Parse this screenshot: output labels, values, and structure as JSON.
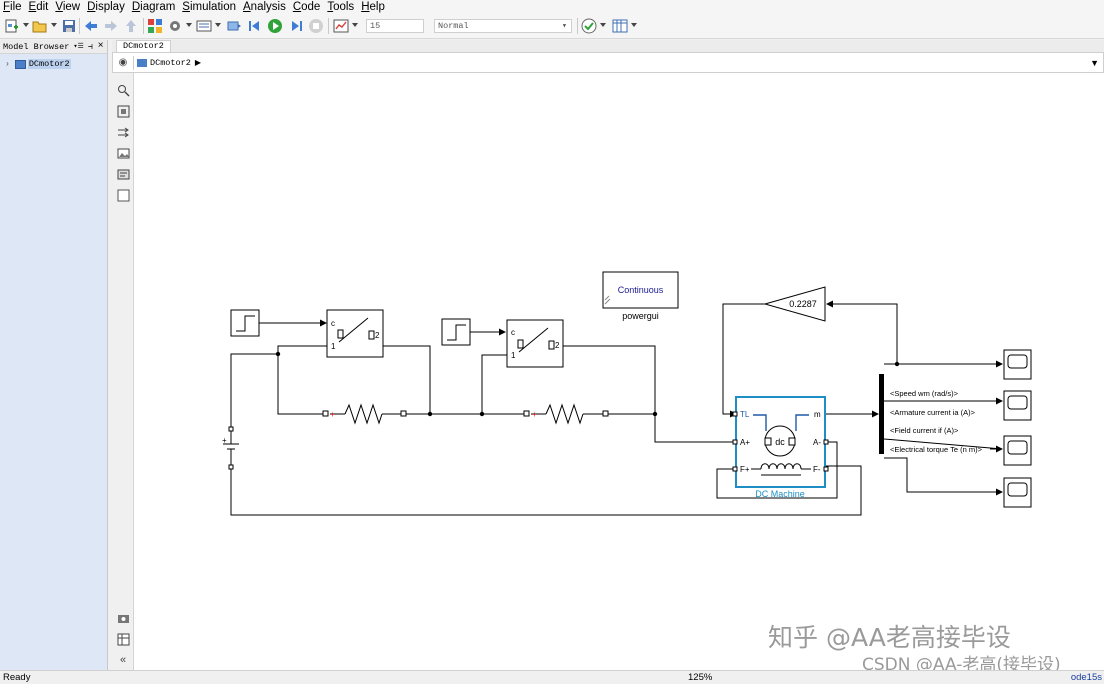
{
  "menu": [
    "File",
    "Edit",
    "View",
    "Display",
    "Diagram",
    "Simulation",
    "Analysis",
    "Code",
    "Tools",
    "Help"
  ],
  "toolbar": {
    "stop_time": "15",
    "sim_mode": "Normal",
    "icons": [
      "new-model-icon",
      "open-icon",
      "save-icon",
      "back-icon",
      "forward-icon",
      "up-icon",
      "library-browser-icon",
      "model-config-icon",
      "model-explorer-icon",
      "build-icon",
      "step-back-icon",
      "run-icon",
      "step-forward-icon",
      "stop-icon",
      "data-inspector-icon",
      "model-advisor-icon",
      "timing-icon"
    ]
  },
  "model_browser": {
    "title": "Model Browser",
    "tree": [
      {
        "label": "DCmotor2"
      }
    ]
  },
  "editor": {
    "tab": "DCmotor2",
    "breadcrumb": "DCmotor2"
  },
  "palette": [
    "zoom-icon",
    "fit-view-icon",
    "arrow-icon",
    "image-icon",
    "annotation-icon",
    "area-icon",
    "screenshot-icon",
    "table-icon",
    "collapse-icon"
  ],
  "diagram": {
    "powergui": {
      "mode": "Continuous",
      "name": "powergui"
    },
    "gain": {
      "value": "0.2287"
    },
    "switch": {
      "port_c": "c",
      "port_1": "1",
      "port_2": "2"
    },
    "machine": {
      "name": "DC Machine",
      "symbol": "dc",
      "ports": {
        "tl": "TL",
        "m": "m",
        "a_plus": "A+",
        "a_minus": "A-",
        "f_plus": "F+",
        "f_minus": "F-"
      }
    },
    "source": {
      "plus": "+"
    },
    "bus_signals": [
      "<Speed wm (rad/s)>",
      "<Armature current ia (A)>",
      "<Field current if (A)>",
      "<Electrical torque Te (n m)>"
    ]
  },
  "status": {
    "left": "Ready",
    "zoom": "125%",
    "solver": "ode15s"
  },
  "watermark": {
    "line1": "知乎 @AA老高接毕设",
    "line2": "CSDN @AA-老高(接毕设)"
  }
}
